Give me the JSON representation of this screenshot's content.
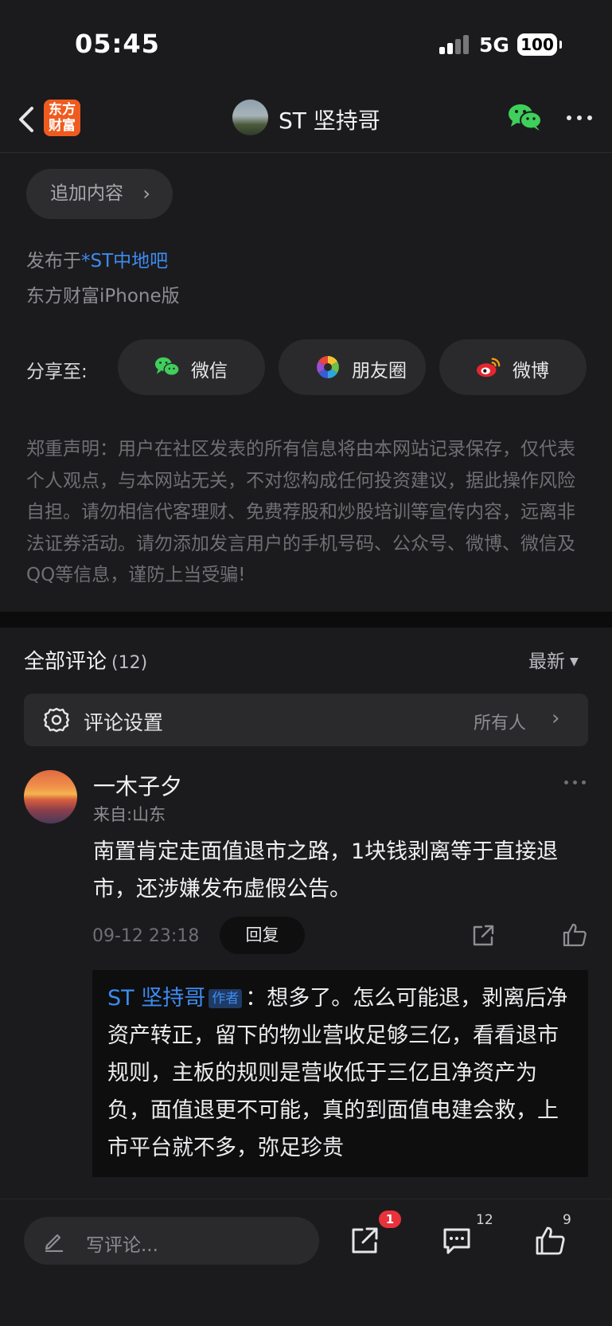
{
  "status": {
    "time": "05:45",
    "network": "5G",
    "battery": "100"
  },
  "nav": {
    "logo_line1": "东方",
    "logo_line2": "财富",
    "title": "ST 坚持哥"
  },
  "post": {
    "add_content_label": "追加内容",
    "posted_prefix": "发布于",
    "posted_forum": "*ST中地吧",
    "client": "东方财富iPhone版"
  },
  "share": {
    "label": "分享至:",
    "buttons": [
      {
        "label": "微信",
        "icon": "wechat-icon"
      },
      {
        "label": "朋友圈",
        "icon": "moments-icon"
      },
      {
        "label": "微博",
        "icon": "weibo-icon"
      }
    ]
  },
  "disclaimer": "郑重声明：用户在社区发表的所有信息将由本网站记录保存，仅代表个人观点，与本网站无关，不对您构成任何投资建议，据此操作风险自担。请勿相信代客理财、免费荐股和炒股培训等宣传内容，远离非法证券活动。请勿添加发言用户的手机号码、公众号、微博、微信及QQ等信息，谨防上当受骗!",
  "comments": {
    "title": "全部评论",
    "count": "(12)",
    "sort": "最新",
    "settings_label": "评论设置",
    "settings_value": "所有人",
    "items": [
      {
        "name": "一木子夕",
        "location": "来自:山东",
        "text": "南置肯定走面值退市之路，1块钱剥离等于直接退市，还涉嫌发布虚假公告。",
        "time": "09-12 23:18",
        "reply_label": "回复",
        "reply": {
          "author": "ST 坚持哥",
          "tag": "作者",
          "separator": "：",
          "text": "想多了。怎么可能退，剥离后净资产转正，留下的物业营收足够三亿，看看退市规则，主板的规则是营收低于三亿且净资产为负，面值退更不可能，真的到面值电建会救，上市平台就不多，弥足珍贵"
        }
      }
    ]
  },
  "bottom": {
    "input_placeholder": "写评论...",
    "share_badge": "1",
    "comment_count": "12",
    "like_count": "9"
  },
  "colors": {
    "background": "#1b1b1d",
    "link": "#3d8bf0",
    "brand": "#ef5b1f",
    "badge": "#e8323c",
    "wechat_green": "#3fcf5b"
  }
}
